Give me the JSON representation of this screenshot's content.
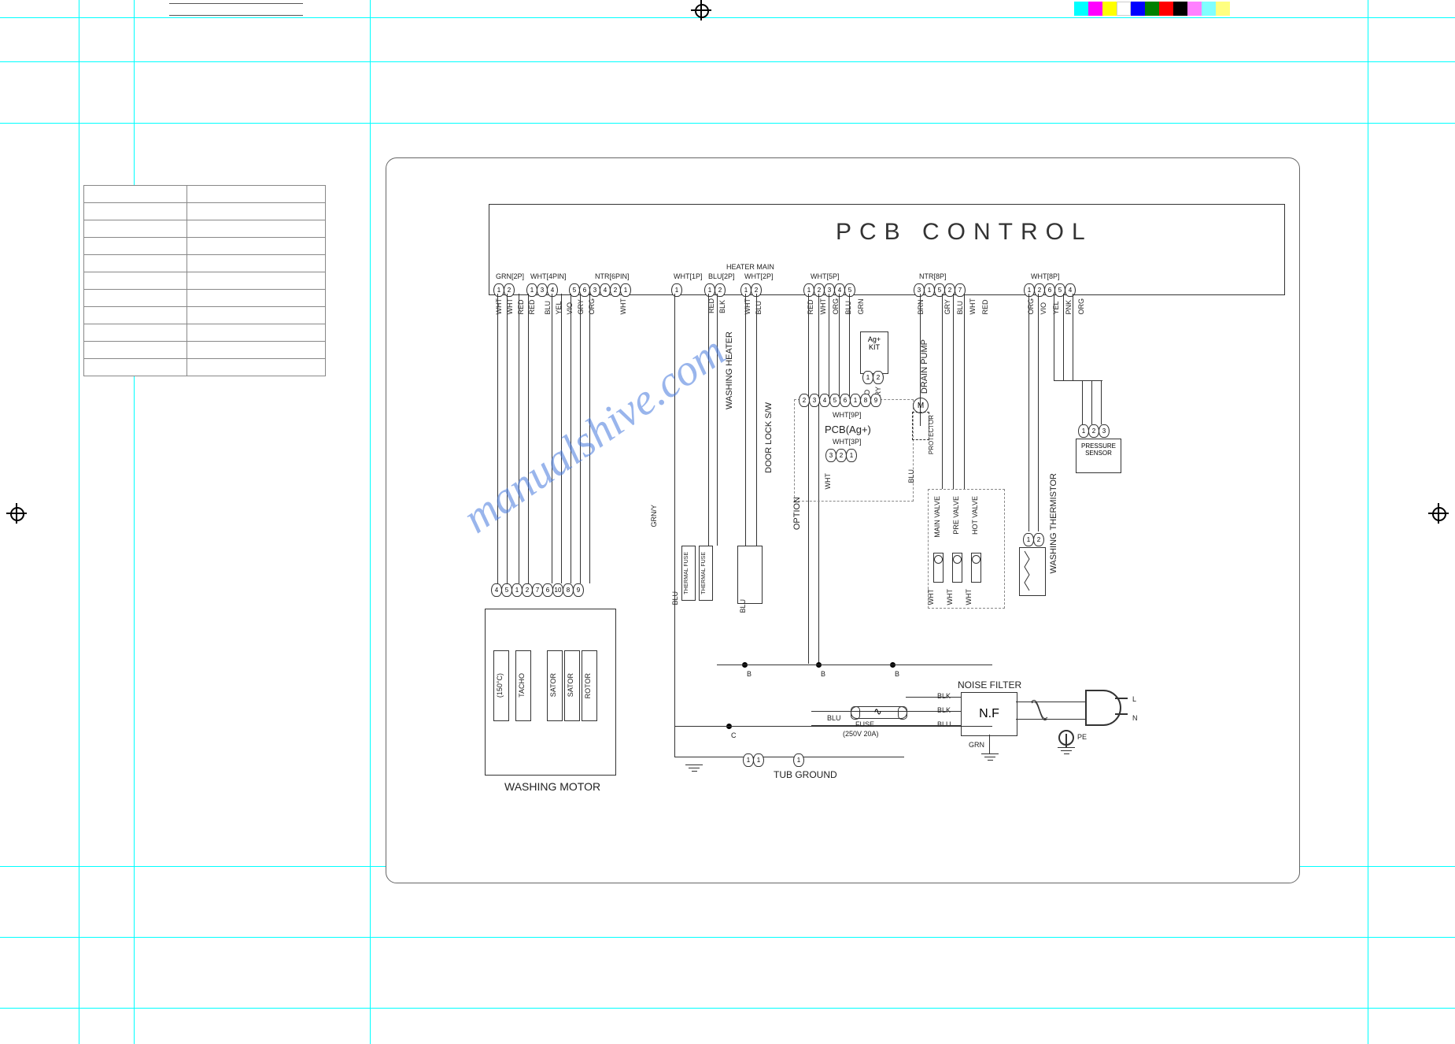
{
  "title": "PCB CONTROL",
  "connectors": {
    "top_left": [
      "GRN[2P]",
      "WHT[4PIN]",
      "NTR[6PIN]",
      "WHT[1P]",
      "BLU[2P]",
      "WHT[2P]"
    ],
    "heater_main": "HEATER MAIN",
    "wht5p": "WHT[5P]",
    "ntr8p": "NTR[8P]",
    "wht8p": "WHT[8P]",
    "wht9p": "WHT[9P]",
    "wht3p": "WHT[3P]"
  },
  "wire_colors_left": [
    "WHT",
    "WHT",
    "RED",
    "RED",
    "BLU",
    "YEL",
    "VIO",
    "GRY",
    "ORG",
    "WHT"
  ],
  "wire_colors_heater": [
    "RED",
    "BLK"
  ],
  "wire_colors_wht2p": [
    "WHT",
    "BLU"
  ],
  "wire_colors_wht5p": [
    "RED",
    "WHT",
    "ORG",
    "BLU",
    "GRN"
  ],
  "wire_colors_ntr8p": [
    "BRN",
    "GRY",
    "BLU",
    "WHT",
    "RED"
  ],
  "wire_colors_wht8p": [
    "ORG",
    "VIO",
    "YEL",
    "PNK",
    "ORG"
  ],
  "option_colors": [
    "VIO",
    "GRY"
  ],
  "pcb_ag_right": "WHT",
  "drain_pump_protector": "BLU",
  "valves": [
    "MAIN VALVE",
    "PRE VALVE",
    "HOT VALVE"
  ],
  "valve_in": "WHT",
  "noise_filter": {
    "label": "NOISE FILTER",
    "box": "N.F",
    "wires": [
      "BLK",
      "BLK",
      "BLU"
    ],
    "grn": "GRN",
    "blu": "BLU"
  },
  "fuse": "FUSE",
  "fuse_rating": "(250V 20A)",
  "tub_ground": "TUB GROUND",
  "washing_motor": "WASHING MOTOR",
  "motor_parts": [
    "(150°C)",
    "TACHO",
    "SATOR",
    "SATOR",
    "ROTOR"
  ],
  "motor_top_pins": [
    "4",
    "5",
    "1",
    "2",
    "7",
    "6",
    "10",
    "8",
    "9"
  ],
  "grn_y": "GRN/Y",
  "blu": "BLU",
  "b": "B",
  "c": "C",
  "washing_heater": "WASHING HEATER",
  "thermal_fuse": "THERMAL FUSE",
  "door_lock": "DOOR LOCK S/W",
  "ag_kit": "Ag+\nKIT",
  "pcb_ag": "PCB(Ag+)",
  "option": "OPTION",
  "drain_pump": "DRAIN PUMP",
  "protector": "PROTECTOR",
  "m": "M",
  "washing_thermistor": "WASHING THERMISTOR",
  "pressure_sensor": "PRESSURE\nSENSOR",
  "mains": [
    "L",
    "N",
    "PE"
  ]
}
